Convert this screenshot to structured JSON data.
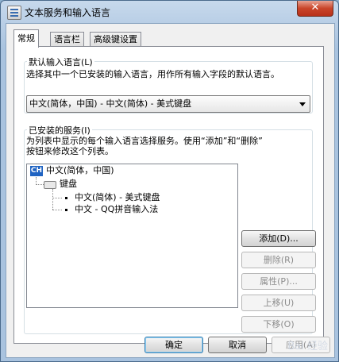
{
  "window": {
    "title": "文本服务和输入语言",
    "close_glyph": "✕"
  },
  "tabs": [
    {
      "label": "常规",
      "active": true
    },
    {
      "label": "语言栏",
      "active": false
    },
    {
      "label": "高级键设置",
      "active": false
    }
  ],
  "default_language": {
    "group_label": "默认输入语言(L)",
    "description": "选择其中一个已安装的输入语言，用作所有输入字段的默认语言。",
    "selected_value": "中文(简体，中国) - 中文(简体) - 美式键盘"
  },
  "installed_services": {
    "group_label": "已安装的服务(I)",
    "description_line1": "为列表中显示的每个输入语言选择服务。使用“添加”和“删除”",
    "description_line2": "按钮来修改这个列表。",
    "tree": {
      "language_badge": "CH",
      "language": "中文(简体，中国)",
      "category": "键盘",
      "items": [
        "中文(简体) - 美式键盘",
        "中文 - QQ拼音输入法"
      ]
    },
    "buttons": {
      "add": "添加(D)...",
      "remove": "删除(R)",
      "properties": "属性(P)...",
      "move_up": "上移(U)",
      "move_down": "下移(O)"
    }
  },
  "footer": {
    "ok": "确定",
    "cancel": "取消",
    "apply": "应用(A)"
  },
  "watermark": "Bai 经验"
}
